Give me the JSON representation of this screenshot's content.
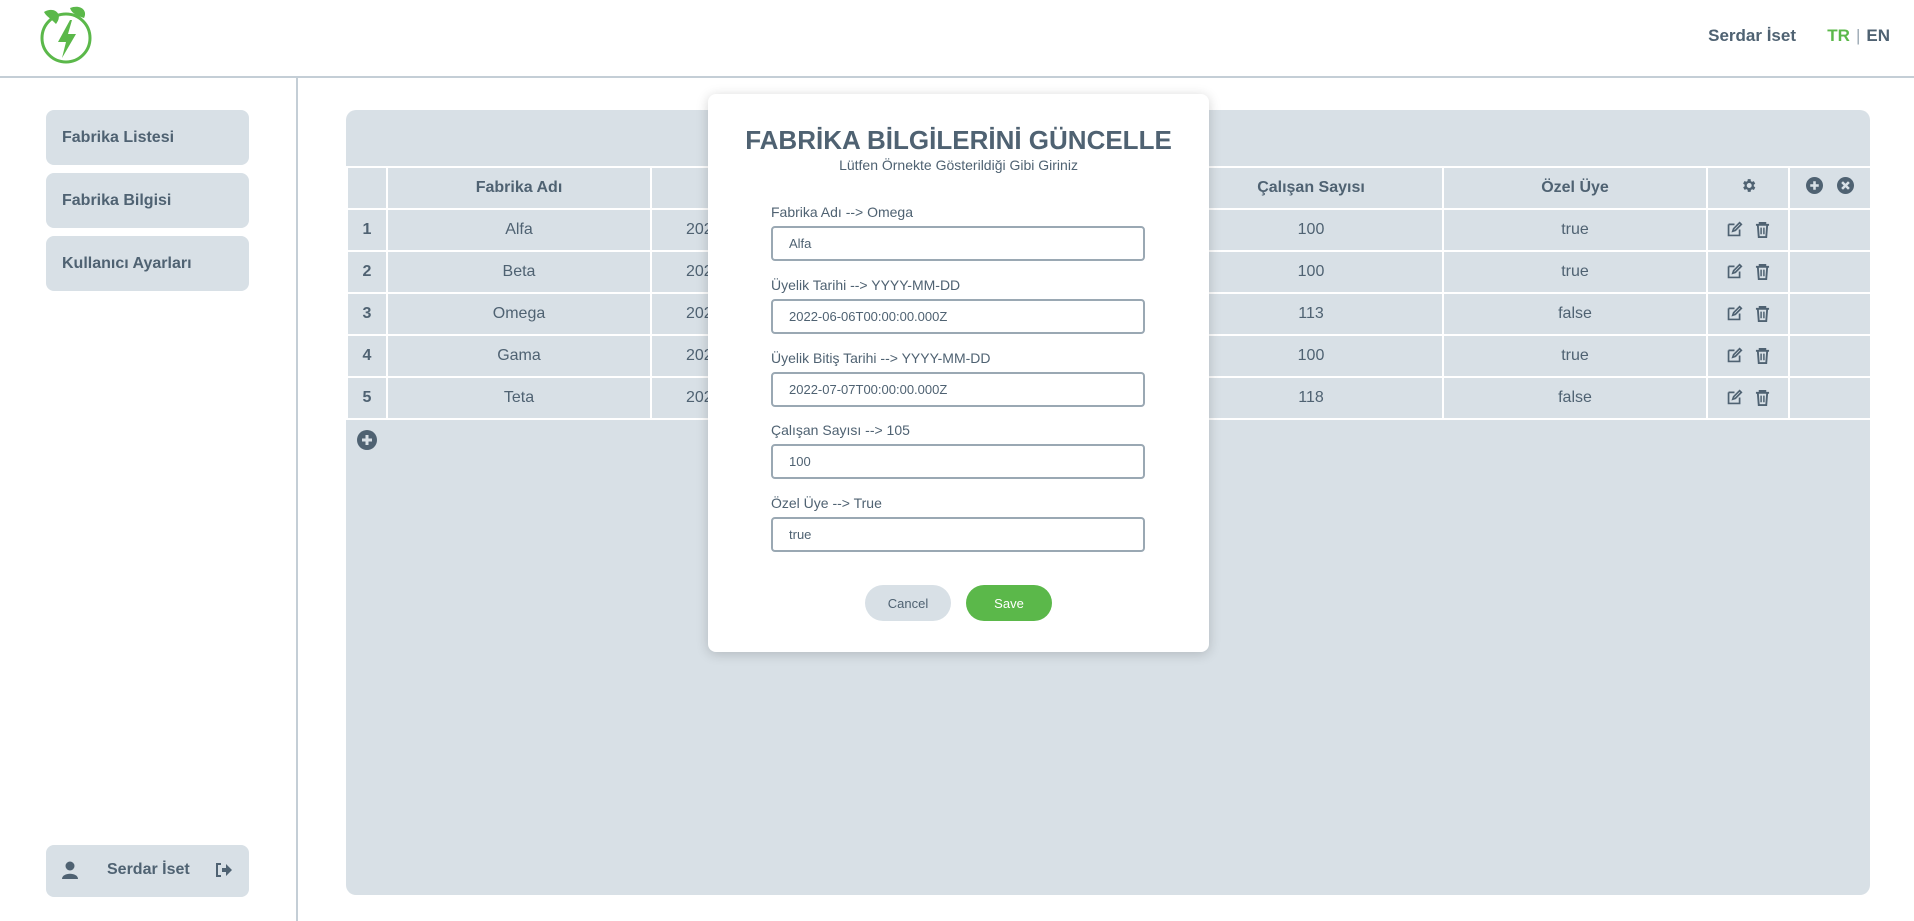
{
  "header": {
    "user_name": "Serdar İset",
    "lang_tr": "TR",
    "lang_separator": "|",
    "lang_en": "EN",
    "logo_icon": "leaf-bolt-logo",
    "accent_color": "#5bb84a"
  },
  "sidebar": {
    "items": [
      {
        "label": "Fabrika Listesi"
      },
      {
        "label": "Fabrika Bilgisi"
      },
      {
        "label": "Kullanıcı Ayarları"
      }
    ],
    "user_name": "Serdar İset",
    "user_icon": "user-icon",
    "logout_icon": "sign-out-icon"
  },
  "table": {
    "columns": [
      "",
      "Fabrika Adı",
      "",
      "",
      "",
      "Çalışan Sayısı",
      "Özel Üye"
    ],
    "rows": [
      {
        "idx": "1",
        "name": "Alfa",
        "date": "202",
        "employees": "100",
        "special": "true"
      },
      {
        "idx": "2",
        "name": "Beta",
        "date": "202",
        "employees": "100",
        "special": "true"
      },
      {
        "idx": "3",
        "name": "Omega",
        "date": "202",
        "employees": "113",
        "special": "false"
      },
      {
        "idx": "4",
        "name": "Gama",
        "date": "202",
        "employees": "100",
        "special": "true"
      },
      {
        "idx": "5",
        "name": "Teta",
        "date": "202",
        "employees": "118",
        "special": "false"
      }
    ]
  },
  "modal": {
    "title": "FABRİKA BİLGİLERİNİ GÜNCELLE",
    "subtitle": "Lütfen Örnekte Gösterildiği Gibi Giriniz",
    "fields": [
      {
        "label": "Fabrika Adı --> Omega",
        "value": "Alfa"
      },
      {
        "label": "Üyelik Tarihi --> YYYY-MM-DD",
        "value": "2022-06-06T00:00:00.000Z"
      },
      {
        "label": "Üyelik Bitiş Tarihi --> YYYY-MM-DD",
        "value": "2022-07-07T00:00:00.000Z"
      },
      {
        "label": "Çalışan Sayısı --> 105",
        "value": "100"
      },
      {
        "label": "Özel Üye --> True",
        "value": "true"
      }
    ],
    "cancel_label": "Cancel",
    "save_label": "Save"
  }
}
